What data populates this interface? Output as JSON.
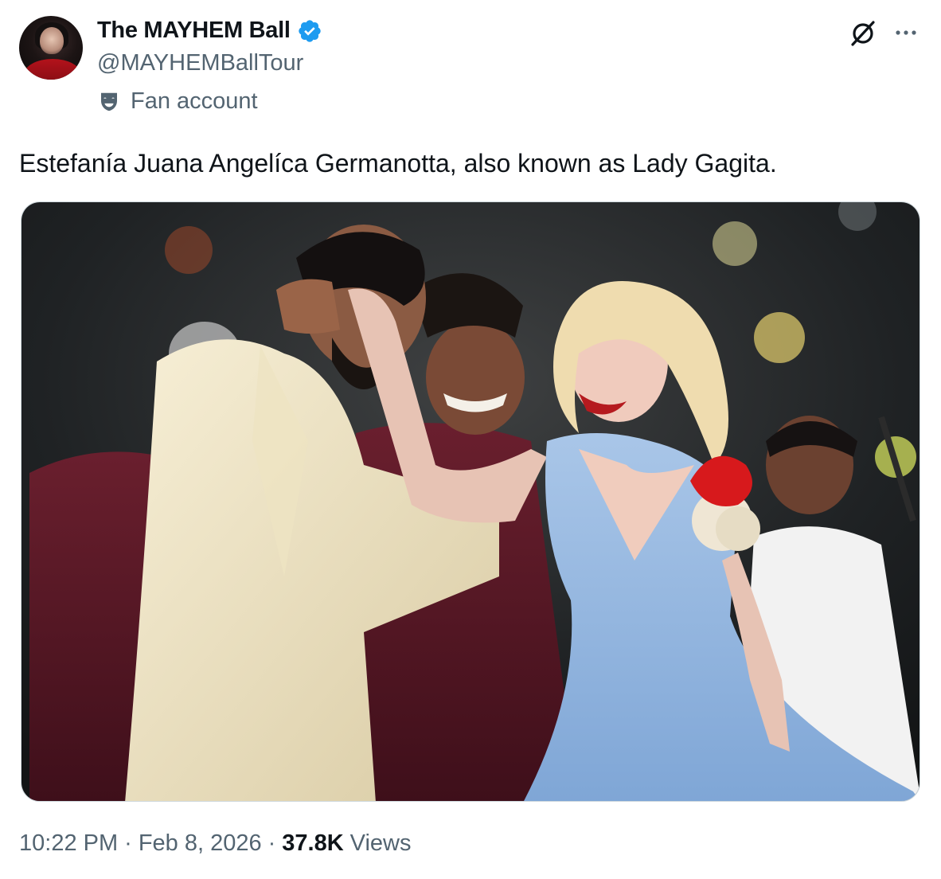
{
  "author": {
    "display_name": "The MAYHEM Ball",
    "handle": "@MAYHEMBallTour",
    "label": "Fan account",
    "avatar_icon": "profile-photo",
    "verified_icon": "verified-badge-icon",
    "verified_color": "#1d9bf0"
  },
  "actions": {
    "grok_icon": "grok-icon",
    "more_icon": "more-icon"
  },
  "tweet": {
    "text": "Estefanía Juana Angelíca Germanotta, also known as Lady Gagita."
  },
  "meta": {
    "time": "10:22 PM",
    "separator": "·",
    "date": "Feb 8, 2026",
    "views_count": "37.8K",
    "views_label": "Views"
  },
  "colors": {
    "text_primary": "#0f1419",
    "text_secondary": "#536471",
    "border": "#cfd9de",
    "accent": "#1d9bf0"
  }
}
